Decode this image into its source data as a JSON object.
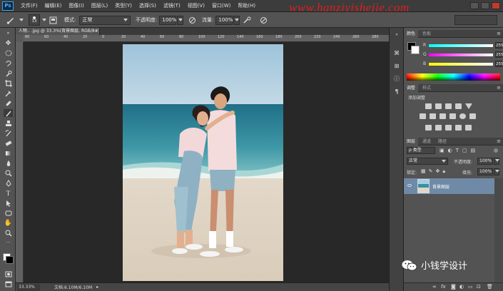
{
  "menubar": {
    "logo": "Ps",
    "items": [
      "文件(F)",
      "编辑(E)",
      "图像(I)",
      "图层(L)",
      "类型(Y)",
      "选择(S)",
      "滤镜(T)",
      "视图(V)",
      "窗口(W)",
      "帮助(H)"
    ]
  },
  "watermark": "www.hanziyishejie.com",
  "options": {
    "brush_size": "13",
    "mode_label": "模式:",
    "mode_value": "正常",
    "opacity_label": "不透明度:",
    "opacity_value": "100%",
    "flow_label": "流量:",
    "flow_value": "100%"
  },
  "document": {
    "tab_title": "人物.. .jpg @ 33.3%(背景图层, RGB/8#) ×",
    "zoom": "33.33%",
    "doc_info": "文档:6.10M/6.10M"
  },
  "ruler": {
    "top_ticks": [
      "80",
      "60",
      "40",
      "20",
      "0",
      "20",
      "40",
      "60",
      "80",
      "100",
      "120",
      "140",
      "160",
      "180",
      "200",
      "220",
      "240",
      "260",
      "280"
    ]
  },
  "color_panel": {
    "tabs": [
      "颜色",
      "色板"
    ],
    "channels": [
      {
        "label": "R",
        "value": "255",
        "gradient": "linear-gradient(to right,#00ffff,#ffffff)"
      },
      {
        "label": "G",
        "value": "255",
        "gradient": "linear-gradient(to right,#ff00ff,#ffffff)"
      },
      {
        "label": "B",
        "value": "255",
        "gradient": "linear-gradient(to right,#ffff00,#ffffff)"
      }
    ]
  },
  "adjustments_panel": {
    "tabs": [
      "调整",
      "样式"
    ],
    "title": "添加调整"
  },
  "layers_panel": {
    "tabs": [
      "图层",
      "通道",
      "路径"
    ],
    "filter_label": "ρ 类型",
    "blend_mode": "正常",
    "opacity_label": "不透明度:",
    "opacity_value": "100%",
    "lock_label": "锁定:",
    "fill_label": "填充:",
    "fill_value": "100%",
    "layer_name": "背景图层"
  },
  "wechat_account": "小钱学设计",
  "colors": {
    "chrome": "#535353",
    "dark": "#282828",
    "selected_layer": "#6f8aa6",
    "watermark": "#d92020"
  }
}
